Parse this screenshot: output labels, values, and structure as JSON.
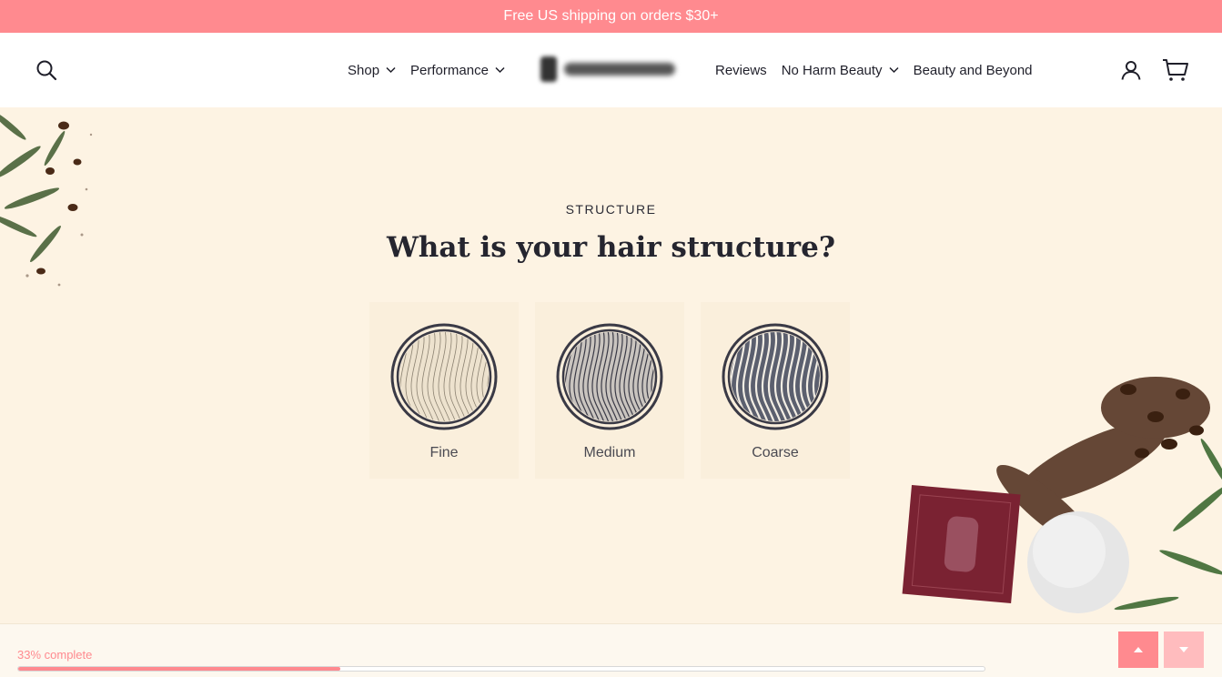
{
  "announcement": "Free US shipping on orders $30+",
  "nav": {
    "left": [
      {
        "label": "Shop",
        "dropdown": true
      },
      {
        "label": "Performance",
        "dropdown": true
      }
    ],
    "right": [
      {
        "label": "Reviews",
        "dropdown": false
      },
      {
        "label": "No Harm Beauty",
        "dropdown": true
      },
      {
        "label": "Beauty and Beyond",
        "dropdown": false
      }
    ]
  },
  "icons": {
    "search": "search-icon",
    "account": "account-icon",
    "cart": "cart-icon",
    "chevron": "chevron-down-icon"
  },
  "quiz": {
    "eyebrow": "STRUCTURE",
    "question": "What is your hair structure?",
    "options": [
      {
        "label": "Fine",
        "tone": "#ede2ce"
      },
      {
        "label": "Medium",
        "tone": "#c9c4bf"
      },
      {
        "label": "Coarse",
        "tone": "#5b5f6e"
      }
    ]
  },
  "progress": {
    "label": "33% complete",
    "fraction": 0.333
  },
  "colors": {
    "accent": "#ff8a8f",
    "accent_light": "#ffbcbe",
    "background": "#fdf3e3",
    "text": "#2b2b35"
  }
}
